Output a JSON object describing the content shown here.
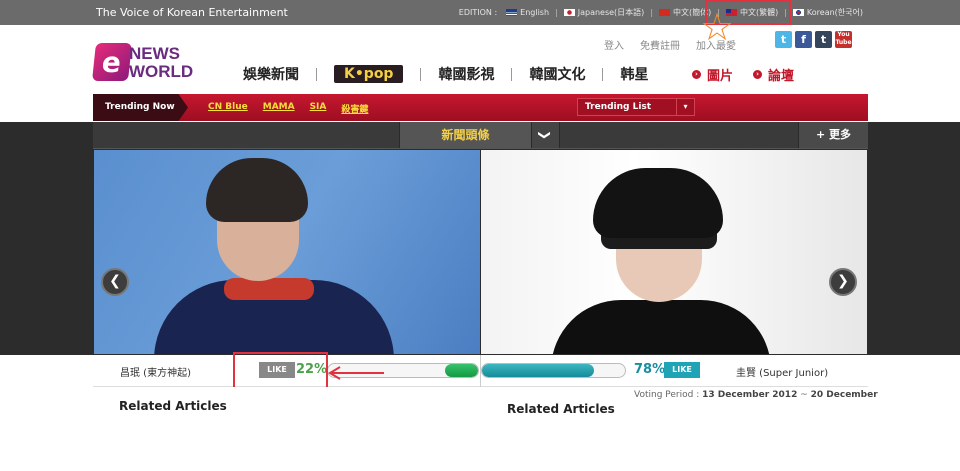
{
  "topbar": {
    "tagline": "The Voice of Korean Entertainment",
    "edition_label": "EDITION :",
    "editions": [
      {
        "label": "English",
        "flag": "us"
      },
      {
        "label": "Japanese(日本語)",
        "flag": "jp"
      },
      {
        "label": "中文(簡体)",
        "flag": "cn"
      },
      {
        "label": "中文(繁體)",
        "flag": "tw"
      },
      {
        "label": "Korean(한국어)",
        "flag": "kr"
      }
    ]
  },
  "header": {
    "logo_news": "NEWS",
    "logo_world": "WORLD",
    "utility": {
      "login": "登入",
      "register": "免費註冊",
      "bookmark": "加入最愛"
    },
    "social": {
      "twitter": "t",
      "facebook": "f",
      "tumblr": "t",
      "youtube": "You Tube"
    },
    "nav": [
      "娛樂新聞",
      "K•pop",
      "韓國影視",
      "韓國文化",
      "韩星"
    ],
    "extras": [
      "圖片",
      "論壇"
    ]
  },
  "trending": {
    "label": "Trending Now",
    "links": [
      "CN Blue",
      "MAMA",
      "SIA",
      "殺害鍵"
    ],
    "select_label": "Trending List",
    "select_arrow": "▾"
  },
  "headbar": {
    "title": "新聞頭條",
    "chevron": "❯",
    "more": "更多",
    "more_icon": "+"
  },
  "slider": {
    "prev": "❮",
    "next": "❯"
  },
  "vote": {
    "left_name": "昌珉 (東方神起)",
    "left_like": "LIKE",
    "left_pct": "22%",
    "left_value": 22,
    "right_name": "圭賢 (Super Junior)",
    "right_like": "LIKE",
    "right_pct": "78%",
    "right_value": 78,
    "period_label": "Voting Period :",
    "period_start": "13 December 2012",
    "period_sep": "~",
    "period_end": "20 December"
  },
  "related": {
    "left": "Related Articles",
    "right": "Related Articles"
  },
  "colors": {
    "accent_red": "#c6172f",
    "highlight_red": "#e0323f",
    "kpop_yellow": "#f5d040",
    "like_green": "#4ba24a",
    "like_teal": "#1a8ea0"
  }
}
